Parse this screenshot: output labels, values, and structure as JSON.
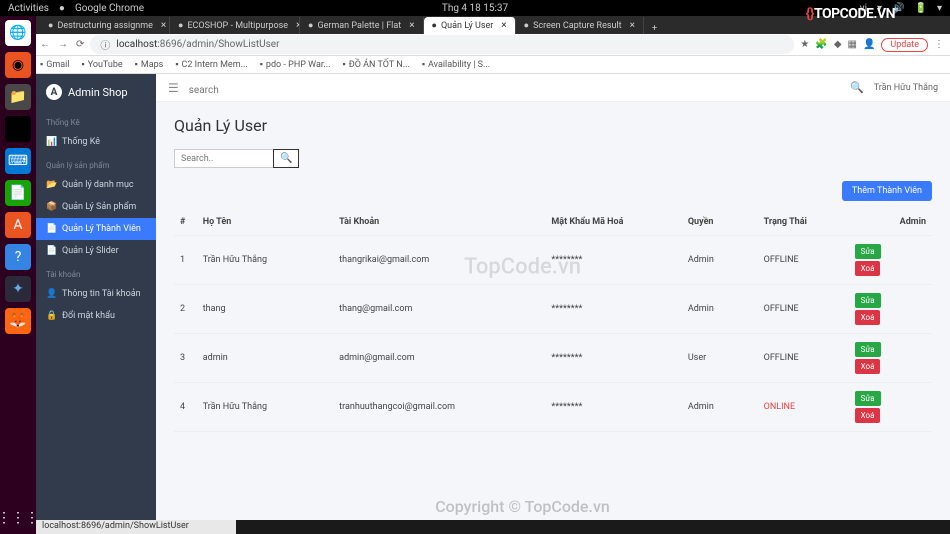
{
  "system": {
    "activities": "Activities",
    "browser_app": "Google Chrome",
    "datetime": "Thg 4 18  15:37",
    "lang": "vi"
  },
  "tabs": [
    {
      "label": "Destructuring assignme",
      "active": false
    },
    {
      "label": "ECOSHOP - Multipurpose",
      "active": false
    },
    {
      "label": "German Palette | Flat",
      "active": false
    },
    {
      "label": "Quản Lý User",
      "active": true
    },
    {
      "label": "Screen Capture Result",
      "active": false
    }
  ],
  "url": {
    "host": "localhost",
    "path": ":8696/admin/ShowListUser"
  },
  "update_btn": "Update",
  "bookmarks": [
    "Gmail",
    "YouTube",
    "Maps",
    "C2 Intern Mem...",
    "pdo - PHP War...",
    "ĐỒ ÁN TỐT N...",
    "Availability | S..."
  ],
  "sidebar": {
    "brand": "Admin Shop",
    "sections": [
      {
        "title": "Thống Kê",
        "items": [
          {
            "icon": "📊",
            "label": "Thống Kê"
          }
        ]
      },
      {
        "title": "Quản lý sản phẩm",
        "items": [
          {
            "icon": "📂",
            "label": "Quản lý danh mục"
          },
          {
            "icon": "📦",
            "label": "Quản Lý Sản phẩm"
          },
          {
            "icon": "📄",
            "label": "Quản Lý Thành Viên",
            "active": true
          },
          {
            "icon": "📄",
            "label": "Quản Lý Slider"
          }
        ]
      },
      {
        "title": "Tài khoản",
        "items": [
          {
            "icon": "👤",
            "label": "Thông tin Tài khoản"
          },
          {
            "icon": "🔒",
            "label": "Đổi mật khẩu"
          }
        ]
      }
    ]
  },
  "topbar": {
    "search_placeholder": "search",
    "user": "Trần Hữu Thắng"
  },
  "page": {
    "title": "Quản Lý User",
    "search_placeholder": "Search..",
    "add_button": "Thêm Thành Viên",
    "headers": [
      "#",
      "Họ Tên",
      "Tài Khoản",
      "Mật Khẩu Mã Hoá",
      "Quyền",
      "Trạng Thái",
      "Admin"
    ],
    "rows": [
      {
        "idx": "1",
        "name": "Trần Hữu Thắng",
        "account": "thangrikai@gmail.com",
        "pw": "********",
        "role": "Admin",
        "status": "OFFLINE",
        "online": false
      },
      {
        "idx": "2",
        "name": "thang",
        "account": "thang@gmail.com",
        "pw": "********",
        "role": "Admin",
        "status": "OFFLINE",
        "online": false
      },
      {
        "idx": "3",
        "name": "admin",
        "account": "admin@gmail.com",
        "pw": "********",
        "role": "User",
        "status": "OFFLINE",
        "online": false
      },
      {
        "idx": "4",
        "name": "Trần Hữu Thắng",
        "account": "tranhuuthangcoi@gmail.com",
        "pw": "********",
        "role": "Admin",
        "status": "ONLINE",
        "online": true
      }
    ],
    "edit_label": "Sửa",
    "delete_label": "Xoá"
  },
  "statusbar": "localhost:8696/admin/ShowListUser",
  "watermark": {
    "logo": "TOPCODE.VN",
    "center": "TopCode.vn",
    "bottom": "Copyright © TopCode.vn"
  }
}
